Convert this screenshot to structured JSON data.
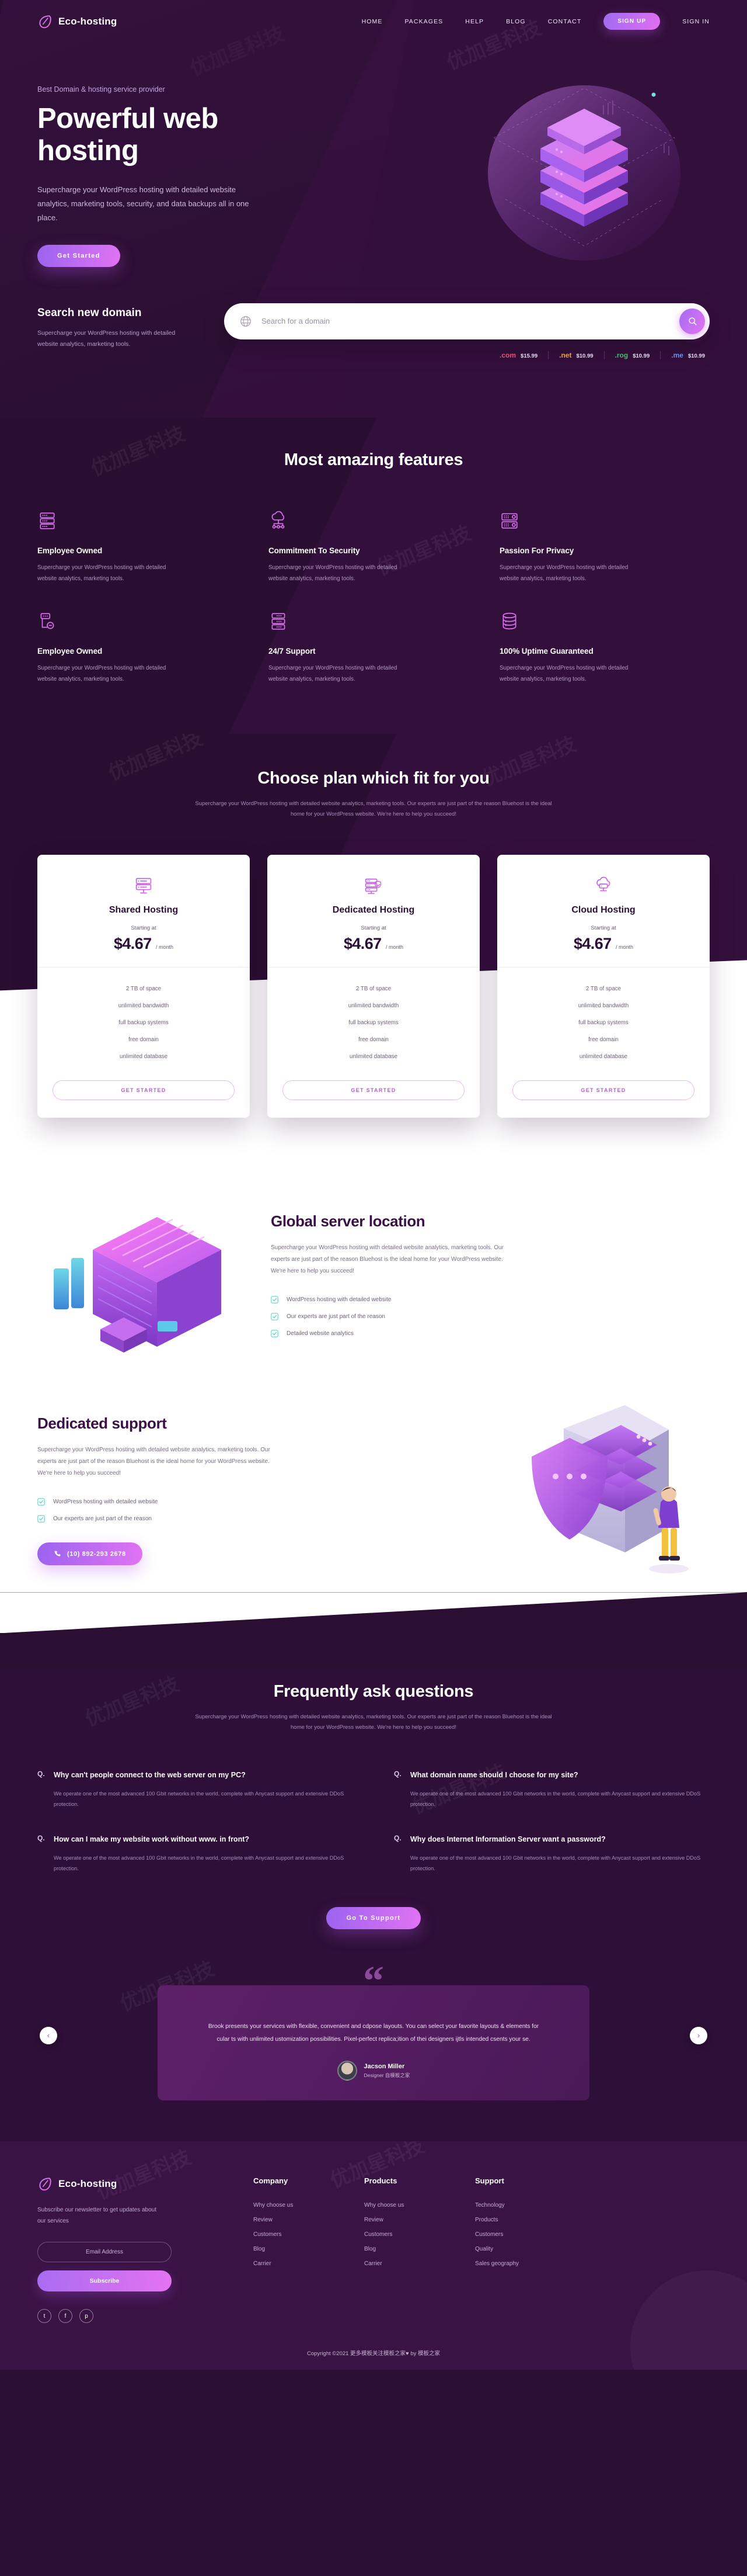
{
  "brand": {
    "name": "Eco-hosting",
    "logo_icon": "leaf-icon"
  },
  "nav": {
    "links": [
      {
        "label": "HOME"
      },
      {
        "label": "PACKAGES"
      },
      {
        "label": "HELP"
      },
      {
        "label": "BLOG"
      },
      {
        "label": "CONTACT"
      }
    ],
    "signup_label": "SIGN UP",
    "signin_label": "SIGN IN"
  },
  "hero": {
    "eyebrow": "Best Domain & hosting service provider",
    "title_line1": "Powerful web",
    "title_line2": "hosting",
    "subtitle": "Supercharge your WordPress hosting with detailed website analytics, marketing tools, security, and data backups all in one place.",
    "cta_label": "Get Started"
  },
  "search": {
    "heading": "Search new domain",
    "description": "Supercharge your WordPress hosting with detailed website analytics, marketing tools.",
    "placeholder": "Search for a domain",
    "value": "",
    "search_icon": "search-icon",
    "globe_icon": "globe-icon",
    "tlds": [
      {
        "ext": ".com",
        "price": "$15.99",
        "color": "#e0557a"
      },
      {
        "ext": ".net",
        "price": "$10.99",
        "color": "#e8a33d"
      },
      {
        "ext": ".rog",
        "price": "$10.99",
        "color": "#4fb870"
      },
      {
        "ext": ".me",
        "price": "$10.99",
        "color": "#5f7fe0"
      }
    ]
  },
  "features": {
    "title": "Most amazing features",
    "items": [
      {
        "icon": "server-rack-icon",
        "title": "Employee Owned",
        "desc": "Supercharge your WordPress hosting with detailed website analytics, marketing tools."
      },
      {
        "icon": "cloud-network-icon",
        "title": "Commitment To Security",
        "desc": "Supercharge your WordPress hosting with detailed website analytics, marketing tools."
      },
      {
        "icon": "server-grid-icon",
        "title": "Passion For Privacy",
        "desc": "Supercharge your WordPress hosting with detailed website analytics, marketing tools."
      },
      {
        "icon": "server-minus-icon",
        "title": "Employee Owned",
        "desc": "Supercharge your WordPress hosting with detailed website analytics, marketing tools."
      },
      {
        "icon": "server-stack-icon",
        "title": "24/7 Support",
        "desc": "Supercharge your WordPress hosting with detailed website analytics, marketing tools."
      },
      {
        "icon": "database-icon",
        "title": "100% Uptime Guaranteed",
        "desc": "Supercharge your WordPress hosting with detailed website analytics, marketing tools."
      }
    ]
  },
  "pricing": {
    "title": "Choose plan which fit for you",
    "subtitle": "Supercharge your WordPress hosting with detailed website analytics, marketing tools. Our experts are just part of the reason Bluehost is the ideal home for your WordPress website. We're here to help you succeed!",
    "starting_label": "Starting at",
    "per_label": "/ month",
    "plans": [
      {
        "icon": "server-monitor-icon",
        "name": "Shared Hosting",
        "price": "$4.67",
        "features": [
          "2 TB of space",
          "unlimited bandwidth",
          "full backup systems",
          "free domain",
          "unlimited database"
        ],
        "cta": "GET STARTED"
      },
      {
        "icon": "server-shield-icon",
        "name": "Dedicated Hosting",
        "price": "$4.67",
        "features": [
          "2 TB of space",
          "unlimited bandwidth",
          "full backup systems",
          "free domain",
          "unlimited database"
        ],
        "cta": "GET STARTED"
      },
      {
        "icon": "cloud-server-icon",
        "name": "Cloud Hosting",
        "price": "$4.67",
        "features": [
          "2 TB of space",
          "unlimited bandwidth",
          "full backup systems",
          "free domain",
          "unlimited database"
        ],
        "cta": "GET STARTED"
      }
    ]
  },
  "global": {
    "title": "Global server location",
    "body": "Supercharge your WordPress hosting with detailed website analytics, marketing tools. Our experts are just part of the reason Bluehost is the ideal home for your WordPress website. We're here to help you succeed!",
    "checks": [
      "WordPress hosting with detailed website",
      "Our experts are just part of the reason",
      "Detailed website analytics"
    ]
  },
  "support": {
    "title": "Dedicated support",
    "body": "Supercharge your WordPress hosting with detailed website analytics, marketing tools. Our experts are just part of the reason Bluehost is the ideal home for your WordPress website. We're here to help you succeed!",
    "checks": [
      "WordPress hosting with detailed website",
      "Our experts are just part of the reason"
    ],
    "phone": "(10) 892-293 2678",
    "phone_icon": "phone-icon"
  },
  "faq": {
    "title": "Frequently ask questions",
    "subtitle": "Supercharge your WordPress hosting with detailed website analytics, marketing tools. Our experts are just part of the reason Bluehost is the ideal home for your WordPress website. We're here to help you succeed!",
    "q_prefix": "Q.",
    "items": [
      {
        "q": "Why can't people connect to the web server on my PC?",
        "a": "We operate one of the most advanced 100 Gbit networks in the world, complete with Anycast support and extensive DDoS protection."
      },
      {
        "q": "What domain name should I choose for my site?",
        "a": "We operate one of the most advanced 100 Gbit networks in the world, complete with Anycast support and extensive DDoS protection."
      },
      {
        "q": "How can I make my website work without www. in front?",
        "a": "We operate one of the most advanced 100 Gbit networks in the world, complete with Anycast support and extensive DDoS protection."
      },
      {
        "q": "Why does Internet Information Server want a password?",
        "a": "We operate one of the most advanced 100 Gbit networks in the world, complete with Anycast support and extensive DDoS protection."
      }
    ],
    "cta": "Go To Support"
  },
  "testimonial": {
    "quote_glyph": "“",
    "text": "Brook presents your services with flexible, convenient and cdpose layouts. You can select your favorite layouts & elements for cular ts with unlimited ustomization possibilities. Pixel-perfect replica;ition of thei designers ijtls intended csents your se.",
    "author": "Jacson Miller",
    "role": "Designer 自模板之家",
    "prev_icon": "chevron-left-icon",
    "next_icon": "chevron-right-icon"
  },
  "footer": {
    "newsletter_text": "Subscribe our newsletter to get updates about our services",
    "email_placeholder": "Email Address",
    "email_value": "",
    "subscribe_label": "Subscribe",
    "socials": [
      {
        "name": "twitter-icon",
        "glyph": "t"
      },
      {
        "name": "facebook-icon",
        "glyph": "f"
      },
      {
        "name": "pinterest-icon",
        "glyph": "p"
      }
    ],
    "columns": [
      {
        "title": "Company",
        "links": [
          "Why choose us",
          "Review",
          "Customers",
          "Blog",
          "Carrier"
        ]
      },
      {
        "title": "Products",
        "links": [
          "Why choose us",
          "Review",
          "Customers",
          "Blog",
          "Carrier"
        ]
      },
      {
        "title": "Support",
        "links": [
          "Technology",
          "Products",
          "Customers",
          "Quality",
          "Sales geography"
        ]
      }
    ],
    "copyright": "Copyright ©2021 更多模板关注模板之家♥ by 模板之家"
  },
  "colors": {
    "bg_dark": "#2b0f33",
    "accent_start": "#9b63ef",
    "accent_end": "#e273f3",
    "footer_bg": "#3a1345"
  }
}
